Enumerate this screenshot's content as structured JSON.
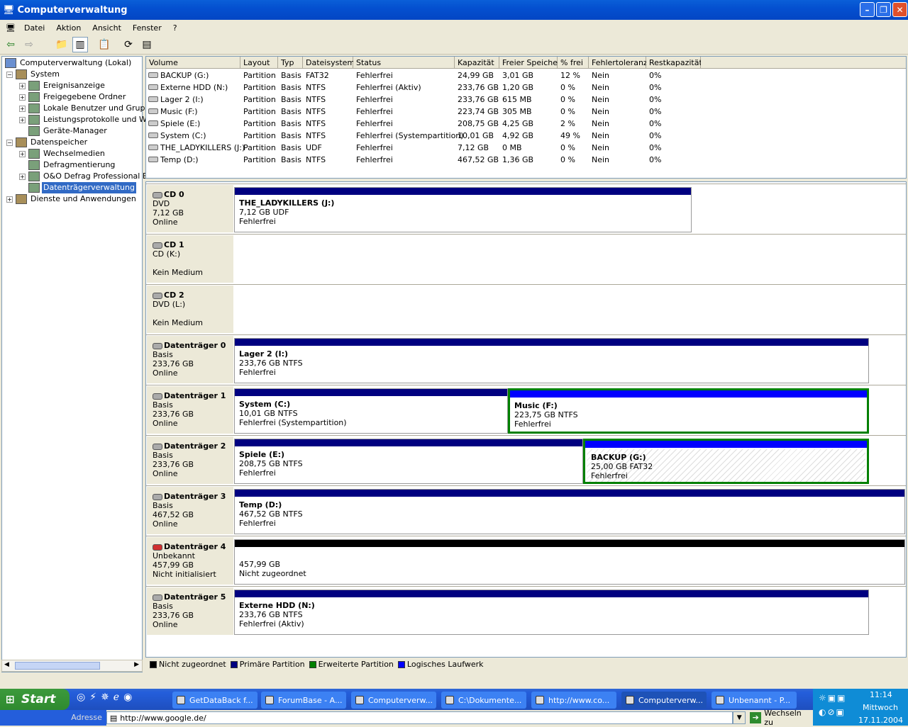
{
  "window": {
    "title": "Computerverwaltung"
  },
  "menu": [
    "Datei",
    "Aktion",
    "Ansicht",
    "Fenster",
    "?"
  ],
  "tree": [
    {
      "label": "Computerverwaltung (Lokal)",
      "level": 0,
      "exp": ""
    },
    {
      "label": "System",
      "level": 1,
      "exp": "−"
    },
    {
      "label": "Ereignisanzeige",
      "level": 2,
      "exp": "+"
    },
    {
      "label": "Freigegebene Ordner",
      "level": 2,
      "exp": "+"
    },
    {
      "label": "Lokale Benutzer und Gruppen",
      "level": 2,
      "exp": "+"
    },
    {
      "label": "Leistungsprotokolle und Warn",
      "level": 2,
      "exp": "+"
    },
    {
      "label": "Geräte-Manager",
      "level": 2,
      "exp": ""
    },
    {
      "label": "Datenspeicher",
      "level": 1,
      "exp": "−"
    },
    {
      "label": "Wechselmedien",
      "level": 2,
      "exp": "+"
    },
    {
      "label": "Defragmentierung",
      "level": 2,
      "exp": ""
    },
    {
      "label": "O&O Defrag Professional Edi",
      "level": 2,
      "exp": "+"
    },
    {
      "label": "Datenträgerverwaltung",
      "level": 2,
      "exp": "",
      "selected": true
    },
    {
      "label": "Dienste und Anwendungen",
      "level": 1,
      "exp": "+"
    }
  ],
  "columns": [
    "Volume",
    "Layout",
    "Typ",
    "Dateisystem",
    "Status",
    "Kapazität",
    "Freier Speicher",
    "% frei",
    "Fehlertoleranz",
    "Restkapazität"
  ],
  "volumes": [
    [
      "BACKUP (G:)",
      "Partition",
      "Basis",
      "FAT32",
      "Fehlerfrei",
      "24,99 GB",
      "3,01 GB",
      "12 %",
      "Nein",
      "0%"
    ],
    [
      "Externe HDD (N:)",
      "Partition",
      "Basis",
      "NTFS",
      "Fehlerfrei (Aktiv)",
      "233,76 GB",
      "1,20 GB",
      "0 %",
      "Nein",
      "0%"
    ],
    [
      "Lager 2 (I:)",
      "Partition",
      "Basis",
      "NTFS",
      "Fehlerfrei",
      "233,76 GB",
      "615 MB",
      "0 %",
      "Nein",
      "0%"
    ],
    [
      "Music (F:)",
      "Partition",
      "Basis",
      "NTFS",
      "Fehlerfrei",
      "223,74 GB",
      "305 MB",
      "0 %",
      "Nein",
      "0%"
    ],
    [
      "Spiele (E:)",
      "Partition",
      "Basis",
      "NTFS",
      "Fehlerfrei",
      "208,75 GB",
      "4,25 GB",
      "2 %",
      "Nein",
      "0%"
    ],
    [
      "System (C:)",
      "Partition",
      "Basis",
      "NTFS",
      "Fehlerfrei (Systempartition)",
      "10,01 GB",
      "4,92 GB",
      "49 %",
      "Nein",
      "0%"
    ],
    [
      "THE_LADYKILLERS (J:)",
      "Partition",
      "Basis",
      "UDF",
      "Fehlerfrei",
      "7,12 GB",
      "0 MB",
      "0 %",
      "Nein",
      "0%"
    ],
    [
      "Temp (D:)",
      "Partition",
      "Basis",
      "NTFS",
      "Fehlerfrei",
      "467,52 GB",
      "1,36 GB",
      "0 %",
      "Nein",
      "0%"
    ]
  ],
  "disks": [
    {
      "name": "CD 0",
      "l1": "DVD",
      "l2": "7,12 GB",
      "l3": "Online"
    },
    {
      "name": "CD 1",
      "l1": "CD (K:)",
      "l2": "",
      "l3": "Kein Medium"
    },
    {
      "name": "CD 2",
      "l1": "DVD (L:)",
      "l2": "",
      "l3": "Kein Medium"
    },
    {
      "name": "Datenträger 0",
      "l1": "Basis",
      "l2": "233,76 GB",
      "l3": "Online"
    },
    {
      "name": "Datenträger 1",
      "l1": "Basis",
      "l2": "233,76 GB",
      "l3": "Online"
    },
    {
      "name": "Datenträger 2",
      "l1": "Basis",
      "l2": "233,76 GB",
      "l3": "Online"
    },
    {
      "name": "Datenträger 3",
      "l1": "Basis",
      "l2": "467,52 GB",
      "l3": "Online"
    },
    {
      "name": "Datenträger 4",
      "l1": "Unbekannt",
      "l2": "457,99 GB",
      "l3": "Nicht initialisiert"
    },
    {
      "name": "Datenträger 5",
      "l1": "Basis",
      "l2": "233,76 GB",
      "l3": "Online"
    }
  ],
  "partitions": [
    {
      "t": "THE_LADYKILLERS (J:)",
      "s": "7,12 GB UDF",
      "st": "Fehlerfrei"
    },
    {
      "t": "Lager 2 (I:)",
      "s": "233,76 GB NTFS",
      "st": "Fehlerfrei"
    },
    {
      "t": "System (C:)",
      "s": "10,01 GB NTFS",
      "st": "Fehlerfrei (Systempartition)"
    },
    {
      "t": "Music (F:)",
      "s": "223,75 GB NTFS",
      "st": "Fehlerfrei"
    },
    {
      "t": "Spiele (E:)",
      "s": "208,75 GB NTFS",
      "st": "Fehlerfrei"
    },
    {
      "t": "BACKUP (G:)",
      "s": "25,00 GB FAT32",
      "st": "Fehlerfrei"
    },
    {
      "t": "Temp (D:)",
      "s": "467,52 GB NTFS",
      "st": "Fehlerfrei"
    },
    {
      "t": "",
      "s": "457,99 GB",
      "st": "Nicht zugeordnet"
    },
    {
      "t": "Externe HDD (N:)",
      "s": "233,76 GB NTFS",
      "st": "Fehlerfrei (Aktiv)"
    }
  ],
  "legend": [
    "Nicht zugeordnet",
    "Primäre Partition",
    "Erweiterte Partition",
    "Logisches Laufwerk"
  ],
  "colors": {
    "unallocated": "#000000",
    "primary": "#000080",
    "extended": "#008000",
    "logical": "#0000ff"
  },
  "taskbar": {
    "start": "Start",
    "tasks": [
      "GetDataBack f...",
      "ForumBase - A...",
      "Computerverw...",
      "C:\\Dokumente...",
      "http://www.co...",
      "Computerverw...",
      "Unbenannt - P..."
    ],
    "time": "11:14",
    "day": "Mittwoch",
    "date": "17.11.2004"
  },
  "address": {
    "label": "Adresse",
    "url": "http://www.google.de/",
    "go": "Wechseln zu"
  }
}
